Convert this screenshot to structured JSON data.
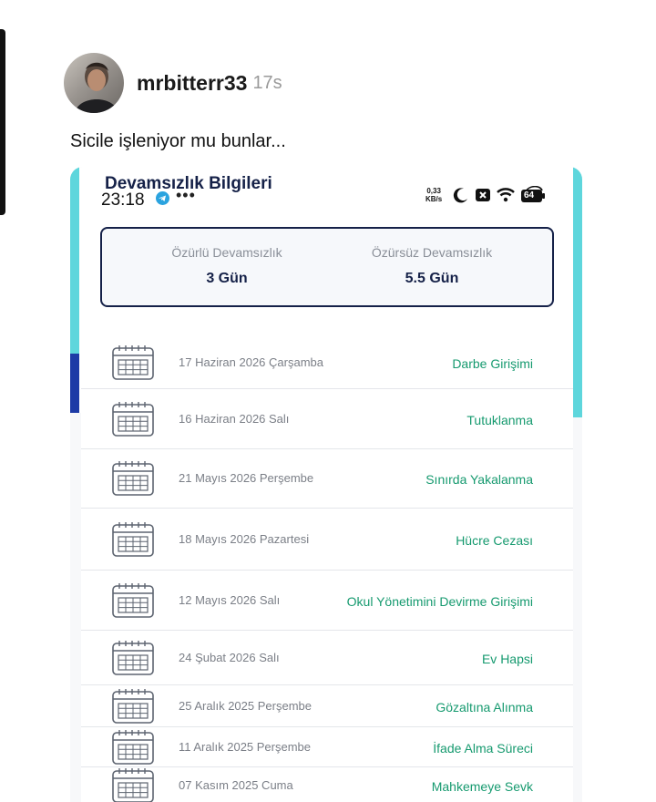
{
  "post": {
    "username": "mrbitterr33",
    "time": "17s",
    "caption": "Sicile işleniyor mu bunlar..."
  },
  "status_bar": {
    "clock": "23:18",
    "dots": "•••",
    "net_speed_value": "0,33",
    "net_speed_unit": "KB/s",
    "battery": "64",
    "icons": [
      "telegram-icon",
      "moon-icon",
      "close-box-icon",
      "wifi-icon",
      "battery-icon"
    ]
  },
  "app": {
    "title": "Devamsızlık Bilgileri",
    "summary": {
      "excused_label": "Özürlü Devamsızlık",
      "excused_value": "3 Gün",
      "unexcused_label": "Özürsüz Devamsızlık",
      "unexcused_value": "5.5 Gün"
    },
    "records": [
      {
        "date": "17 Haziran  2026 Çarşamba",
        "reason": "Darbe Girişimi"
      },
      {
        "date": "16 Haziran  2026 Salı",
        "reason": "Tutuklanma"
      },
      {
        "date": "21 Mayıs  2026 Perşembe",
        "reason": "Sınırda Yakalanma"
      },
      {
        "date": "18 Mayıs  2026 Pazartesi",
        "reason": "Hücre Cezası"
      },
      {
        "date": "12 Mayıs  2026 Salı",
        "reason": "Okul Yönetimini Devirme Girişimi"
      },
      {
        "date": "24 Şubat  2026 Salı",
        "reason": "Ev Hapsi"
      },
      {
        "date": "25 Aralık  2025 Perşembe",
        "reason": "Gözaltına Alınma"
      },
      {
        "date": "11 Aralık  2025 Perşembe",
        "reason": "İfade Alma Süreci"
      },
      {
        "date": "07 Kasım  2025 Cuma",
        "reason": "Mahkemeye Sevk"
      }
    ]
  },
  "colors": {
    "navy": "#152148",
    "teal_accent": "#5ed6dc",
    "reason_green": "#169a6f"
  }
}
